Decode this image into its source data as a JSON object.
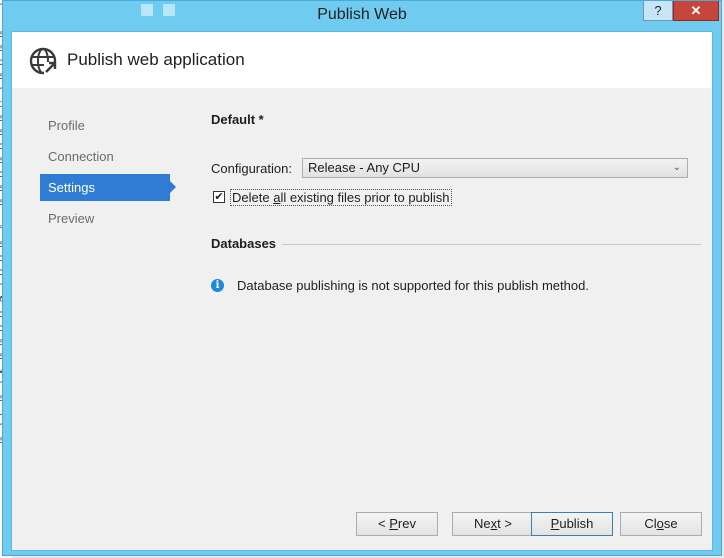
{
  "background_text": [
    "r",
    "i",
    "e",
    "a",
    "p",
    "e",
    "re",
    "t",
    "e",
    "e",
    "c",
    "e",
    "oi",
    "ex",
    "e",
    "l",
    "fi",
    "ex",
    "o",
    "ol",
    "r",
    "A",
    "o",
    "o",
    "a",
    "e",
    "v",
    "ri",
    "e",
    "u",
    "r",
    "a"
  ],
  "window": {
    "title": "Publish Web",
    "help_label": "?",
    "close_label": "✕"
  },
  "header": {
    "title": "Publish web application",
    "icon": "globe-publish-icon"
  },
  "nav": {
    "items": [
      {
        "label": "Profile",
        "active": false
      },
      {
        "label": "Connection",
        "active": false
      },
      {
        "label": "Settings",
        "active": true
      },
      {
        "label": "Preview",
        "active": false
      }
    ]
  },
  "settings": {
    "profile_name": "Default *",
    "configuration_label": "Configuration:",
    "configuration_value": "Release - Any CPU",
    "delete_files": {
      "checked": true,
      "label_pre": "Delete ",
      "label_accel": "a",
      "label_post": "ll existing files prior to publish"
    },
    "databases_title": "Databases",
    "databases_message": "Database publishing is not supported for this publish method."
  },
  "footer": {
    "prev": {
      "pre": "< ",
      "accel": "P",
      "post": "rev"
    },
    "next": {
      "pre": "Ne",
      "accel": "x",
      "post": "t >"
    },
    "publish": {
      "pre": "",
      "accel": "P",
      "post": "ublish"
    },
    "close": {
      "pre": "Cl",
      "accel": "o",
      "post": "se"
    }
  },
  "colors": {
    "accent": "#2e7cd3",
    "frame": "#6fcbf0",
    "close_button": "#c7463b",
    "info_icon": "#1e8ad6"
  }
}
